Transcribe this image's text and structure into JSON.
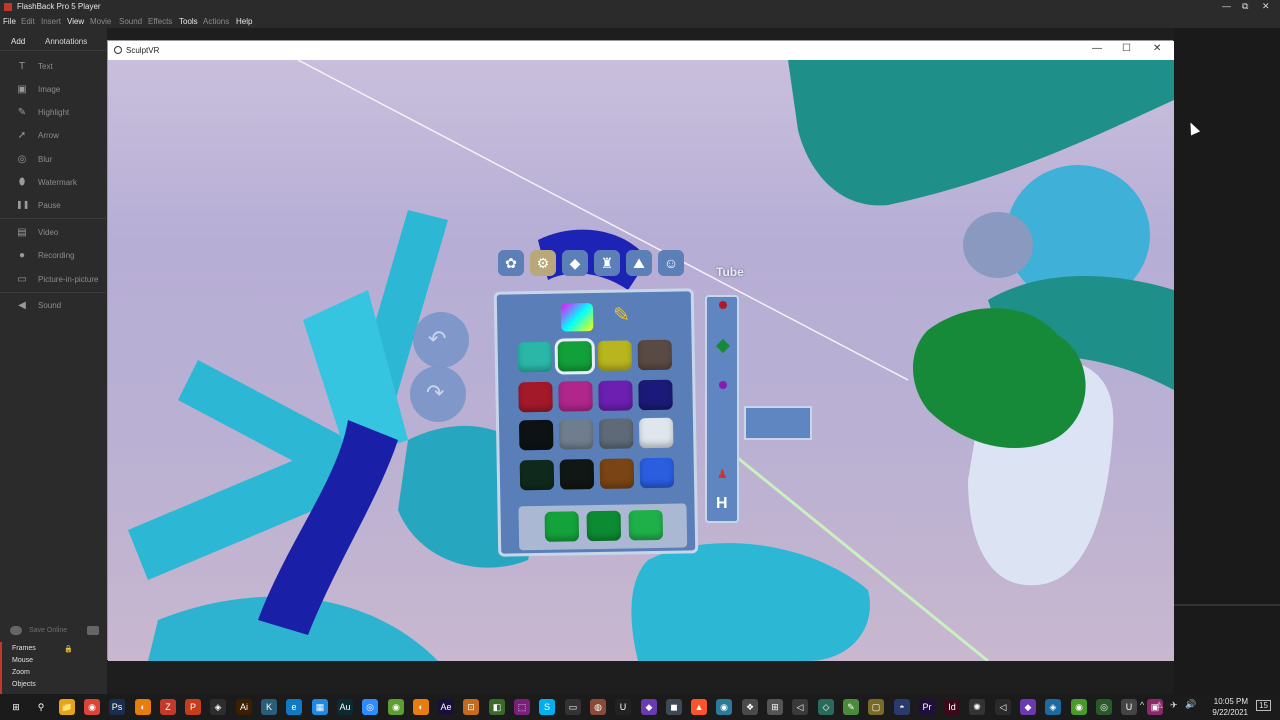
{
  "fb_window": {
    "title": "FlashBack Pro 5 Player",
    "controls": [
      "—",
      "⧉",
      "✕"
    ]
  },
  "menubar": [
    {
      "label": "File",
      "enabled": true
    },
    {
      "label": "Edit",
      "enabled": false
    },
    {
      "label": "Insert",
      "enabled": false
    },
    {
      "label": "View",
      "enabled": true
    },
    {
      "label": "Movie",
      "enabled": false
    },
    {
      "label": "Sound",
      "enabled": false
    },
    {
      "label": "Effects",
      "enabled": false
    },
    {
      "label": "Tools",
      "enabled": true
    },
    {
      "label": "Actions",
      "enabled": false
    },
    {
      "label": "Help",
      "enabled": true
    }
  ],
  "left_panel": {
    "tabs": [
      "Add",
      "Annotations"
    ],
    "items": [
      {
        "label": "Text",
        "icon": "T"
      },
      {
        "label": "Image",
        "icon": "▣"
      },
      {
        "label": "Highlight",
        "icon": "✎"
      },
      {
        "label": "Arrow",
        "icon": "➚"
      },
      {
        "label": "Blur",
        "icon": "◎"
      },
      {
        "label": "Watermark",
        "icon": "⬮"
      },
      {
        "label": "Pause",
        "icon": "❚❚"
      },
      {
        "label": "Video",
        "icon": "▤"
      },
      {
        "label": "Recording",
        "icon": "●"
      },
      {
        "label": "Picture-in-picture",
        "icon": "▭"
      },
      {
        "label": "Sound",
        "icon": "◀"
      }
    ],
    "save_online": "Save Online",
    "bottom_list": [
      "Frames",
      "Mouse",
      "Zoom",
      "Objects"
    ]
  },
  "sculpt_window": {
    "title": "SculptVR",
    "controls": [
      "—",
      "☐",
      "✕"
    ],
    "tool_label": "Tube"
  },
  "palette": {
    "colors": [
      [
        "#2bb7a8",
        "#12a03a",
        "#b9b51e",
        "#5a4a44"
      ],
      [
        "#a3192a",
        "#b0268a",
        "#6c1fb0",
        "#1c1a78"
      ],
      [
        "#0d1214",
        "#6f7e8e",
        "#5e6a78",
        "#dfe6ee"
      ],
      [
        "#0f2a1c",
        "#111714",
        "#7a4414",
        "#2b5de0"
      ]
    ],
    "selected": "#12a03a",
    "tray_colors": [
      "#14a23a",
      "#0d8b32",
      "#20b04a"
    ]
  },
  "taskbar": {
    "time": "10:05 PM",
    "date": "9/22/2021",
    "icons": [
      {
        "name": "windows-start-icon",
        "glyph": "⊞",
        "color": "#1b1b1b"
      },
      {
        "name": "search-icon",
        "glyph": "⚲",
        "color": "#1b1b1b"
      },
      {
        "name": "file-explorer-icon",
        "glyph": "📁",
        "color": "#e8a317"
      },
      {
        "name": "chrome-icon",
        "glyph": "◉",
        "color": "#db4437"
      },
      {
        "name": "photoshop-icon",
        "glyph": "Ps",
        "color": "#1a2f4d"
      },
      {
        "name": "blender-icon",
        "glyph": "◐",
        "color": "#e87d0d"
      },
      {
        "name": "filezilla-icon",
        "glyph": "Z",
        "color": "#c0392b"
      },
      {
        "name": "powerpoint-icon",
        "glyph": "P",
        "color": "#c43e1c"
      },
      {
        "name": "app-icon-1",
        "glyph": "◈",
        "color": "#2d2d2d"
      },
      {
        "name": "illustrator-icon",
        "glyph": "Ai",
        "color": "#3a1f00"
      },
      {
        "name": "inkscape-icon",
        "glyph": "K",
        "color": "#2a5d7a"
      },
      {
        "name": "edge-icon",
        "glyph": "e",
        "color": "#0f7ac4"
      },
      {
        "name": "store-icon",
        "glyph": "▦",
        "color": "#1e88e5"
      },
      {
        "name": "audition-icon",
        "glyph": "Au",
        "color": "#0a2b33"
      },
      {
        "name": "zoom-icon",
        "glyph": "◎",
        "color": "#2d8cff"
      },
      {
        "name": "app-icon-2",
        "glyph": "◉",
        "color": "#5c9e31"
      },
      {
        "name": "blender-icon-2",
        "glyph": "◐",
        "color": "#e87d0d"
      },
      {
        "name": "after-effects-icon",
        "glyph": "Ae",
        "color": "#1a0f3a"
      },
      {
        "name": "app-icon-3",
        "glyph": "⊡",
        "color": "#c46a1a"
      },
      {
        "name": "app-icon-4",
        "glyph": "◧",
        "color": "#3a6a2a"
      },
      {
        "name": "app-icon-5",
        "glyph": "⬚",
        "color": "#7a1f7a"
      },
      {
        "name": "skype-icon",
        "glyph": "S",
        "color": "#00aff0"
      },
      {
        "name": "app-icon-6",
        "glyph": "▭",
        "color": "#333"
      },
      {
        "name": "obs-icon",
        "glyph": "◍",
        "color": "#8a4a3a"
      },
      {
        "name": "unreal-icon",
        "glyph": "U",
        "color": "#222"
      },
      {
        "name": "visual-studio-icon",
        "glyph": "◆",
        "color": "#6a3ab0"
      },
      {
        "name": "app-icon-7",
        "glyph": "◼",
        "color": "#3d4a55"
      },
      {
        "name": "brave-icon",
        "glyph": "▲",
        "color": "#fb542b"
      },
      {
        "name": "app-icon-8",
        "glyph": "◉",
        "color": "#2a7a9a"
      },
      {
        "name": "app-icon-9",
        "glyph": "❖",
        "color": "#4a4a4a"
      },
      {
        "name": "app-icon-10",
        "glyph": "⊞",
        "color": "#555"
      },
      {
        "name": "app-icon-11",
        "glyph": "◁",
        "color": "#3a3a3a"
      },
      {
        "name": "app-icon-12",
        "glyph": "◇",
        "color": "#2a6a5a"
      },
      {
        "name": "app-icon-13",
        "glyph": "✎",
        "color": "#4a8a3a"
      },
      {
        "name": "app-icon-14",
        "glyph": "▢",
        "color": "#7a6a2a"
      },
      {
        "name": "app-icon-15",
        "glyph": "◓",
        "color": "#2a3a6a"
      },
      {
        "name": "premiere-icon",
        "glyph": "Pr",
        "color": "#1f0f3a"
      },
      {
        "name": "indesign-icon",
        "glyph": "Id",
        "color": "#3a0a1a"
      },
      {
        "name": "app-icon-16",
        "glyph": "✺",
        "color": "#333"
      },
      {
        "name": "app-icon-17",
        "glyph": "◁",
        "color": "#2a2a2a"
      },
      {
        "name": "visual-studio-icon-2",
        "glyph": "◆",
        "color": "#6a3ab0"
      },
      {
        "name": "app-icon-18",
        "glyph": "◈",
        "color": "#1e6aa0"
      },
      {
        "name": "app-icon-19",
        "glyph": "◉",
        "color": "#4a9a2a"
      },
      {
        "name": "app-icon-20",
        "glyph": "◎",
        "color": "#2a5a2a"
      },
      {
        "name": "unreal-icon-2",
        "glyph": "U",
        "color": "#444"
      },
      {
        "name": "app-icon-21",
        "glyph": "▣",
        "color": "#8a2a6a"
      }
    ],
    "tray": [
      "^",
      "⚠",
      "✈",
      "🔊",
      "🖧"
    ],
    "notification": "15"
  }
}
